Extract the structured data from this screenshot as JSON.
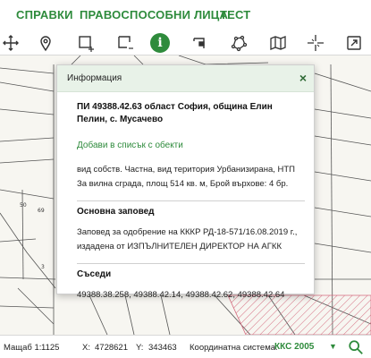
{
  "menu": {
    "items": [
      {
        "label": "СПРАВКИ"
      },
      {
        "label": "ПРАВОСПОСОБНИ ЛИЦА"
      },
      {
        "label": "ТЕСТ"
      }
    ]
  },
  "toolbar": {
    "tools": [
      {
        "icon": "move-icon"
      },
      {
        "icon": "map-pin-icon"
      },
      {
        "icon": "select-rectangle-icon"
      },
      {
        "icon": "select-area-icon"
      },
      {
        "icon": "info-icon",
        "glyph": "i",
        "active": true
      },
      {
        "icon": "print-region-icon"
      },
      {
        "icon": "polygon-measure-icon"
      },
      {
        "icon": "map-layers-icon"
      },
      {
        "icon": "crosshair-icon"
      },
      {
        "icon": "fullscreen-icon"
      }
    ]
  },
  "map": {
    "labels": [
      "50",
      "69",
      "3"
    ]
  },
  "dialog": {
    "title": "Информация",
    "close": "×",
    "object_title": "ПИ 49388.42.63 област София, община Елин Пелин, с. Мусачево",
    "add_link": "Добави в списък с обекти",
    "description": "вид собств. Частна, вид територия Урбанизирана, НТП За вилна сграда, площ 514 кв. м, Брой върхове: 4 бр.",
    "order_heading": "Основна заповед",
    "order_text": "Заповед за одобрение на КККР РД-18-571/16.08.2019 г., издадена от ИЗПЪЛНИТЕЛЕН ДИРЕКТОР НА АГКК",
    "neighbours_heading": "Съседи",
    "neighbours": "49388.38.258, 49388.42.14, 49388.42.62, 49388.42.64"
  },
  "status": {
    "scale_label": "Мащаб 1:",
    "scale_value": "1125",
    "x_label": "X:",
    "x_value": "4728621",
    "y_label": "Y:",
    "y_value": "343463",
    "crs_label": "Координатна система:",
    "crs_value": "ККС 2005",
    "crs_caret": "▼"
  },
  "colors": {
    "accent": "#2e8b3c",
    "dialog_header": "#e8f2e8",
    "map_bg": "#f7f6f1",
    "hatch": "#d46a7e"
  }
}
